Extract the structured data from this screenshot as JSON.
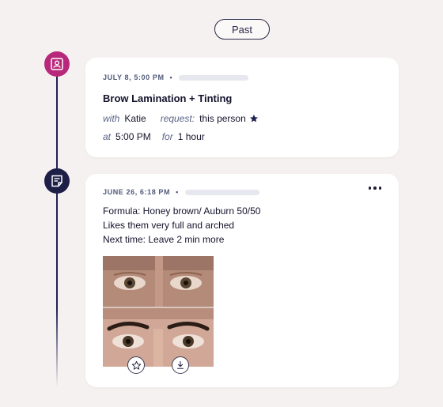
{
  "filter": {
    "past_label": "Past"
  },
  "appointments": [
    {
      "date_time": "JULY 8, 5:00 PM",
      "dot": "•",
      "title": "Brow Lamination + Tinting",
      "with_label": "with",
      "with_value": "Katie",
      "request_label": "request:",
      "request_value": "this person",
      "at_label": "at",
      "at_value": "5:00 PM",
      "for_label": "for",
      "for_value": "1 hour",
      "icon": "contact-card-icon"
    }
  ],
  "notes": [
    {
      "date_time": "JUNE 26, 6:18 PM",
      "dot": "•",
      "lines": [
        "Formula: Honey brown/ Auburn 50/50",
        "Likes them very full and arched",
        "Next time: Leave 2 min more"
      ],
      "icon": "note-icon",
      "photo_actions": [
        "star-icon",
        "download-icon"
      ]
    }
  ],
  "colors": {
    "appointment_node": "#b8287a",
    "note_node": "#1d1f47",
    "background": "#f6f1f1"
  }
}
